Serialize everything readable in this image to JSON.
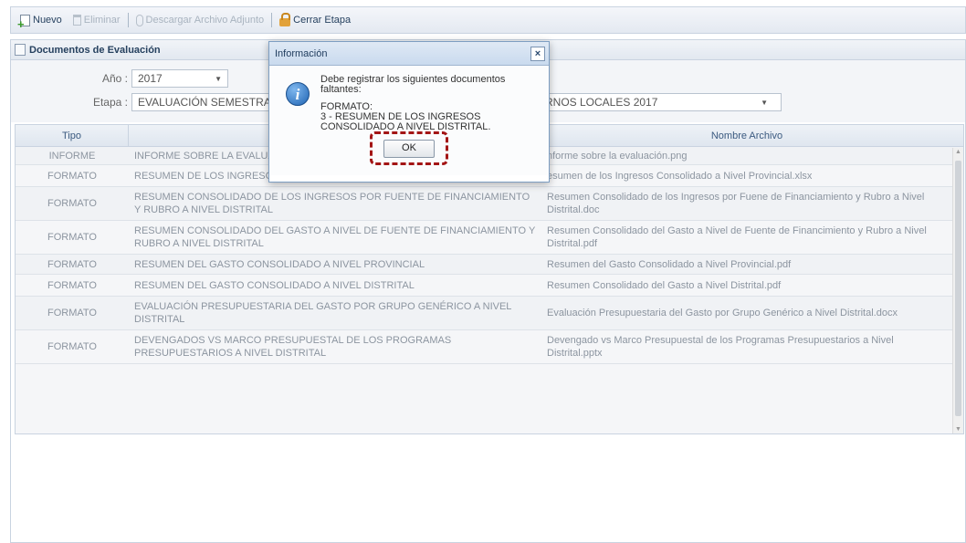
{
  "toolbar": {
    "nuevo": "Nuevo",
    "eliminar": "Eliminar",
    "descargar": "Descargar Archivo Adjunto",
    "cerrar_etapa": "Cerrar Etapa"
  },
  "panel": {
    "title": "Documentos de Evaluación"
  },
  "form": {
    "anio_label": "Año :",
    "anio_value": "2017",
    "etapa_label": "Etapa :",
    "etapa_value_left": "EVALUACIÓN SEMESTRAL",
    "etapa_value_right": "RNOS LOCALES 2017"
  },
  "grid": {
    "headers": {
      "tipo": "Tipo",
      "documento": "",
      "nombre_archivo": "Nombre Archivo"
    },
    "rows": [
      {
        "tipo": "INFORME",
        "documento": "INFORME SOBRE LA EVALUAC",
        "archivo": "nforme sobre la evaluación.png"
      },
      {
        "tipo": "FORMATO",
        "documento": "RESUMEN DE LOS INGRESOS",
        "archivo": "esumen de los Ingresos Consolidado a Nivel Provincial.xlsx"
      },
      {
        "tipo": "FORMATO",
        "documento": "RESUMEN CONSOLIDADO DE LOS INGRESOS POR FUENTE DE FINANCIAMIENTO Y RUBRO A NIVEL DISTRITAL",
        "archivo": "Resumen Consolidado de los Ingresos por Fuene de Financiamiento y Rubro a Nivel Distrital.doc"
      },
      {
        "tipo": "FORMATO",
        "documento": "RESUMEN CONSOLIDADO DEL GASTO A NIVEL DE FUENTE DE FINANCIAMIENTO Y RUBRO A NIVEL DISTRITAL",
        "archivo": "Resumen Consolidado del Gasto a Nivel de Fuente de Financimiento y Rubro a Nivel Distrital.pdf"
      },
      {
        "tipo": "FORMATO",
        "documento": "RESUMEN DEL GASTO CONSOLIDADO A NIVEL PROVINCIAL",
        "archivo": "Resumen del Gasto Consolidado a Nivel Provincial.pdf"
      },
      {
        "tipo": "FORMATO",
        "documento": "RESUMEN DEL GASTO CONSOLIDADO A NIVEL DISTRITAL",
        "archivo": "Resumen Consolidado del Gasto a Nivel Distrital.pdf"
      },
      {
        "tipo": "FORMATO",
        "documento": "EVALUACIÓN PRESUPUESTARIA DEL GASTO POR GRUPO GENÉRICO A NIVEL DISTRITAL",
        "archivo": "Evaluación Presupuestaria del Gasto por Grupo Genérico a Nivel Distrital.docx"
      },
      {
        "tipo": "FORMATO",
        "documento": "DEVENGADOS VS MARCO PRESUPUESTAL DE LOS PROGRAMAS PRESUPUESTARIOS A NIVEL DISTRITAL",
        "archivo": "Devengado vs Marco Presupuestal de los Programas Presupuestarios a Nivel Distrital.pptx"
      }
    ]
  },
  "dialog": {
    "title": "Información",
    "close": "×",
    "line1": "Debe registrar los siguientes documentos",
    "line2": "faltantes:",
    "line3": "FORMATO:",
    "line4": "3 - RESUMEN DE LOS INGRESOS",
    "line5": "CONSOLIDADO A NIVEL DISTRITAL.",
    "ok": "OK",
    "info_icon_glyph": "i"
  }
}
